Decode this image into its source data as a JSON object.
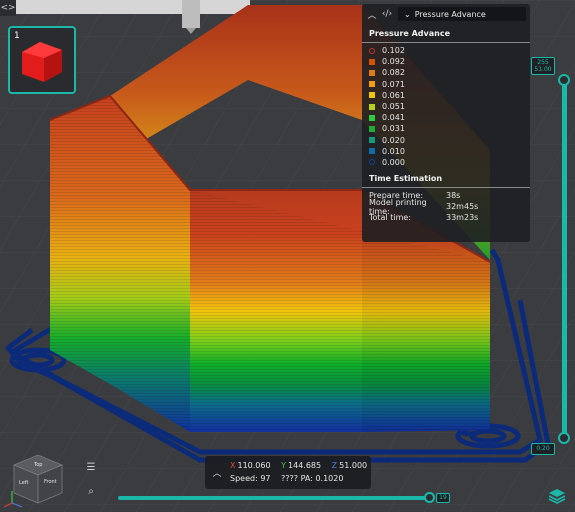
{
  "top_left": {
    "button_label": "<>"
  },
  "thumbnail": {
    "plate_number": "1"
  },
  "legend": {
    "view_mode": "Pressure Advance",
    "title": "Pressure Advance",
    "items": [
      {
        "label": "0.102",
        "color": "#c0392b"
      },
      {
        "label": "0.092",
        "color": "#d35400"
      },
      {
        "label": "0.082",
        "color": "#e07b1a"
      },
      {
        "label": "0.071",
        "color": "#f39c12"
      },
      {
        "label": "0.061",
        "color": "#f1c40f"
      },
      {
        "label": "0.051",
        "color": "#b7d11a"
      },
      {
        "label": "0.041",
        "color": "#2ecc40"
      },
      {
        "label": "0.031",
        "color": "#1faa3a"
      },
      {
        "label": "0.020",
        "color": "#149a7a"
      },
      {
        "label": "0.010",
        "color": "#0e6fa8"
      },
      {
        "label": "0.000",
        "color": "#1a3fa6"
      }
    ],
    "time_estimation": {
      "title": "Time Estimation",
      "rows": [
        {
          "label": "Prepare time:",
          "value": "38s"
        },
        {
          "label": "Model printing time:",
          "value": "32m45s"
        },
        {
          "label": "Total time:",
          "value": "33m23s"
        }
      ]
    }
  },
  "vertical_slider": {
    "top_label_line1": "255",
    "top_label_line2": "51.00",
    "bottom_label": "0.20"
  },
  "horizontal_slider": {
    "value_label": "19"
  },
  "info_box": {
    "x_label": "X",
    "x_value": "110.060",
    "y_label": "Y",
    "y_value": "144.685",
    "z_label": "Z",
    "z_value": "51.000",
    "speed_text": "Speed: 97",
    "pa_text": "???? PA: 0.1020"
  },
  "view_cube": {
    "top": "Top",
    "left": "Left",
    "front": "Front"
  },
  "colors": {
    "accent": "#19b8a8",
    "travel": "#0b2a7a"
  }
}
